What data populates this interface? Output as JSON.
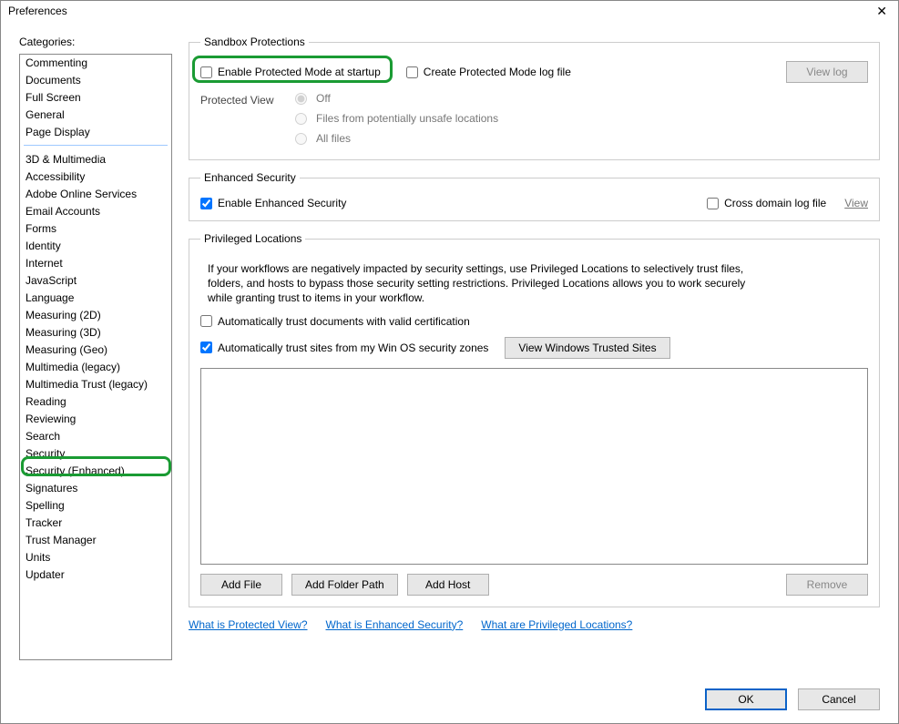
{
  "window": {
    "title": "Preferences"
  },
  "sidebar": {
    "label": "Categories:",
    "group1": [
      "Commenting",
      "Documents",
      "Full Screen",
      "General",
      "Page Display"
    ],
    "group2": [
      "3D & Multimedia",
      "Accessibility",
      "Adobe Online Services",
      "Email Accounts",
      "Forms",
      "Identity",
      "Internet",
      "JavaScript",
      "Language",
      "Measuring (2D)",
      "Measuring (3D)",
      "Measuring (Geo)",
      "Multimedia (legacy)",
      "Multimedia Trust (legacy)",
      "Reading",
      "Reviewing",
      "Search",
      "Security",
      "Security (Enhanced)",
      "Signatures",
      "Spelling",
      "Tracker",
      "Trust Manager",
      "Units",
      "Updater"
    ]
  },
  "sandbox": {
    "legend": "Sandbox Protections",
    "enable_protected": "Enable Protected Mode at startup",
    "create_log": "Create Protected Mode log file",
    "view_log": "View log",
    "protected_view_label": "Protected View",
    "pv_off": "Off",
    "pv_unsafe": "Files from potentially unsafe locations",
    "pv_all": "All files"
  },
  "enhanced": {
    "legend": "Enhanced Security",
    "enable": "Enable Enhanced Security",
    "cross_log": "Cross domain log file",
    "view": "View"
  },
  "priv": {
    "legend": "Privileged Locations",
    "desc": "If your workflows are negatively impacted by security settings, use Privileged Locations to selectively trust files, folders, and hosts to bypass those security setting restrictions. Privileged Locations allows you to work securely while granting trust to items in your workflow.",
    "auto_trust_cert": "Automatically trust documents with valid certification",
    "auto_trust_sites": "Automatically trust sites from my Win OS security zones",
    "view_trusted": "View Windows Trusted Sites",
    "add_file": "Add File",
    "add_folder": "Add Folder Path",
    "add_host": "Add Host",
    "remove": "Remove"
  },
  "help": {
    "pv": "What is Protected View?",
    "es": "What is Enhanced Security?",
    "pl": "What are Privileged Locations?"
  },
  "footer": {
    "ok": "OK",
    "cancel": "Cancel"
  }
}
